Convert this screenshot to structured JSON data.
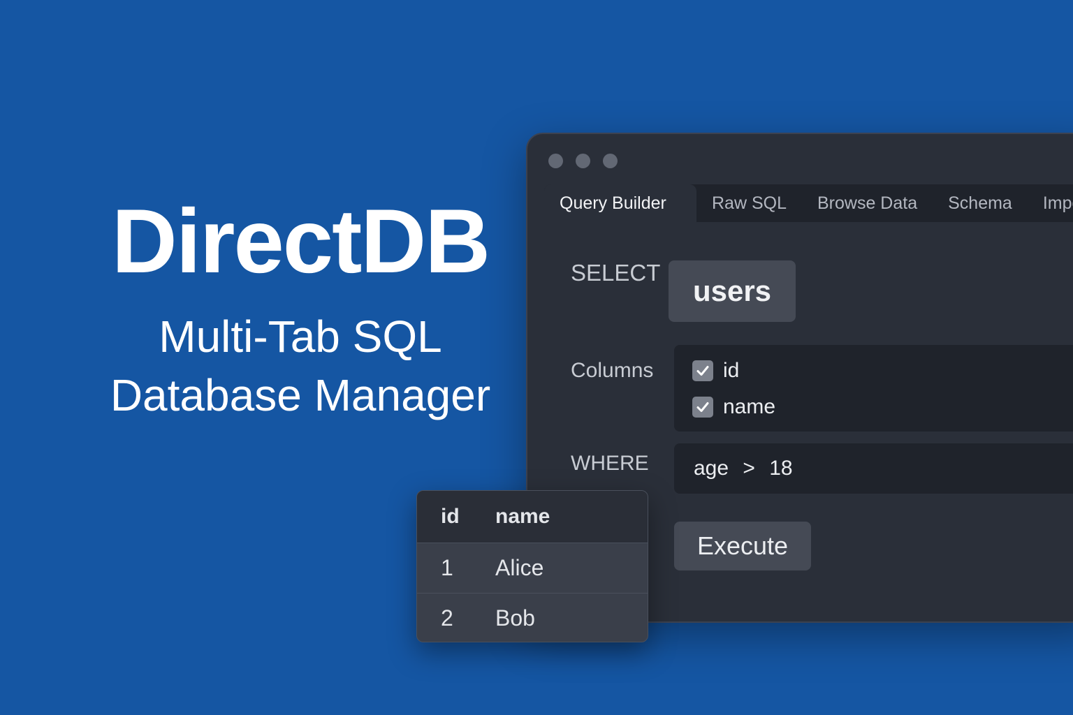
{
  "hero": {
    "title": "DirectDB",
    "subtitle_line1": "Multi-Tab SQL",
    "subtitle_line2": "Database Manager"
  },
  "window": {
    "tabs": [
      {
        "label": "Query Builder",
        "active": true
      },
      {
        "label": "Raw SQL",
        "active": false
      },
      {
        "label": "Browse Data",
        "active": false
      },
      {
        "label": "Schema",
        "active": false
      },
      {
        "label": "Impo",
        "active": false
      }
    ],
    "select_label": "SELECT",
    "table_name": "users",
    "columns_label": "Columns",
    "columns": [
      {
        "name": "id",
        "checked": true
      },
      {
        "name": "name",
        "checked": true
      }
    ],
    "where_label": "WHERE",
    "where_expression": "age > 18",
    "execute_label": "Execute"
  },
  "results": {
    "headers": [
      "id",
      "name"
    ],
    "rows": [
      [
        "1",
        "Alice"
      ],
      [
        "2",
        "Bob"
      ]
    ]
  },
  "colors": {
    "background": "#1556a3",
    "window": "#2a2f39",
    "panel": "#1f232b",
    "button": "#454a55"
  }
}
